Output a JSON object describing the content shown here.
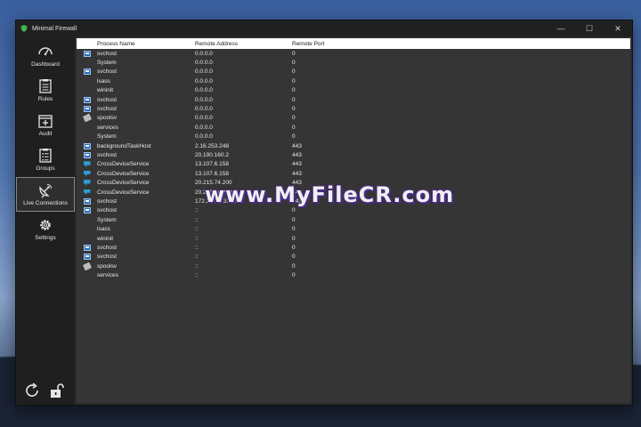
{
  "window": {
    "title": "Minimal Firewall",
    "minimize": "—",
    "maximize": "☐",
    "close": "✕"
  },
  "sidebar": {
    "items": [
      {
        "label": "Dashboard",
        "icon": "dashboard-icon"
      },
      {
        "label": "Rules",
        "icon": "rules-icon"
      },
      {
        "label": "Audit",
        "icon": "audit-icon"
      },
      {
        "label": "Groups",
        "icon": "groups-icon"
      },
      {
        "label": "Live Connections",
        "icon": "satellite-icon",
        "active": true
      },
      {
        "label": "Settings",
        "icon": "gear-icon"
      }
    ],
    "bottom_icons": [
      "refresh-icon",
      "unlock-icon"
    ]
  },
  "table": {
    "columns": [
      "Process Name",
      "Remote Address",
      "Remote Port"
    ],
    "rows": [
      {
        "icon": "exe",
        "process": "svchost",
        "address": "0.0.0.0",
        "port": "0"
      },
      {
        "icon": "none",
        "process": "System",
        "address": "0.0.0.0",
        "port": "0"
      },
      {
        "icon": "exe",
        "process": "svchost",
        "address": "0.0.0.0",
        "port": "0"
      },
      {
        "icon": "none",
        "process": "lsass",
        "address": "0.0.0.0",
        "port": "0"
      },
      {
        "icon": "none",
        "process": "wininit",
        "address": "0.0.0.0",
        "port": "0"
      },
      {
        "icon": "exe",
        "process": "svchost",
        "address": "0.0.0.0",
        "port": "0"
      },
      {
        "icon": "exe",
        "process": "svchost",
        "address": "0.0.0.0",
        "port": "0"
      },
      {
        "icon": "printer",
        "process": "spoolsv",
        "address": "0.0.0.0",
        "port": "0"
      },
      {
        "icon": "none",
        "process": "services",
        "address": "0.0.0.0",
        "port": "0"
      },
      {
        "icon": "none",
        "process": "System",
        "address": "0.0.0.0",
        "port": "0"
      },
      {
        "icon": "exe",
        "process": "backgroundTaskHost",
        "address": "2.16.253.248",
        "port": "443"
      },
      {
        "icon": "exe",
        "process": "svchost",
        "address": "20.190.160.2",
        "port": "443"
      },
      {
        "icon": "cds",
        "process": "CrossDeviceService",
        "address": "13.107.6.158",
        "port": "443"
      },
      {
        "icon": "cds",
        "process": "CrossDeviceService",
        "address": "13.107.6.158",
        "port": "443"
      },
      {
        "icon": "cds",
        "process": "CrossDeviceService",
        "address": "20.215.74.200",
        "port": "443"
      },
      {
        "icon": "cds",
        "process": "CrossDeviceService",
        "address": "20.215.74.200",
        "port": "443"
      },
      {
        "icon": "exe",
        "process": "svchost",
        "address": "172.211.123.250",
        "port": "443"
      },
      {
        "icon": "exe",
        "process": "svchost",
        "address": "::",
        "port": "0"
      },
      {
        "icon": "none",
        "process": "System",
        "address": "::",
        "port": "0"
      },
      {
        "icon": "none",
        "process": "lsass",
        "address": "::",
        "port": "0"
      },
      {
        "icon": "none",
        "process": "wininit",
        "address": "::",
        "port": "0"
      },
      {
        "icon": "exe",
        "process": "svchost",
        "address": "::",
        "port": "0"
      },
      {
        "icon": "exe",
        "process": "svchost",
        "address": "::",
        "port": "0"
      },
      {
        "icon": "printer",
        "process": "spoolsv",
        "address": "::",
        "port": "0"
      },
      {
        "icon": "none",
        "process": "services",
        "address": "::",
        "port": "0"
      }
    ]
  },
  "watermark": "www.MyFileCR.com",
  "colors": {
    "accent": "#2b6cb8",
    "sidebar_bg": "#1f1f1f",
    "content_bg": "#353535"
  }
}
